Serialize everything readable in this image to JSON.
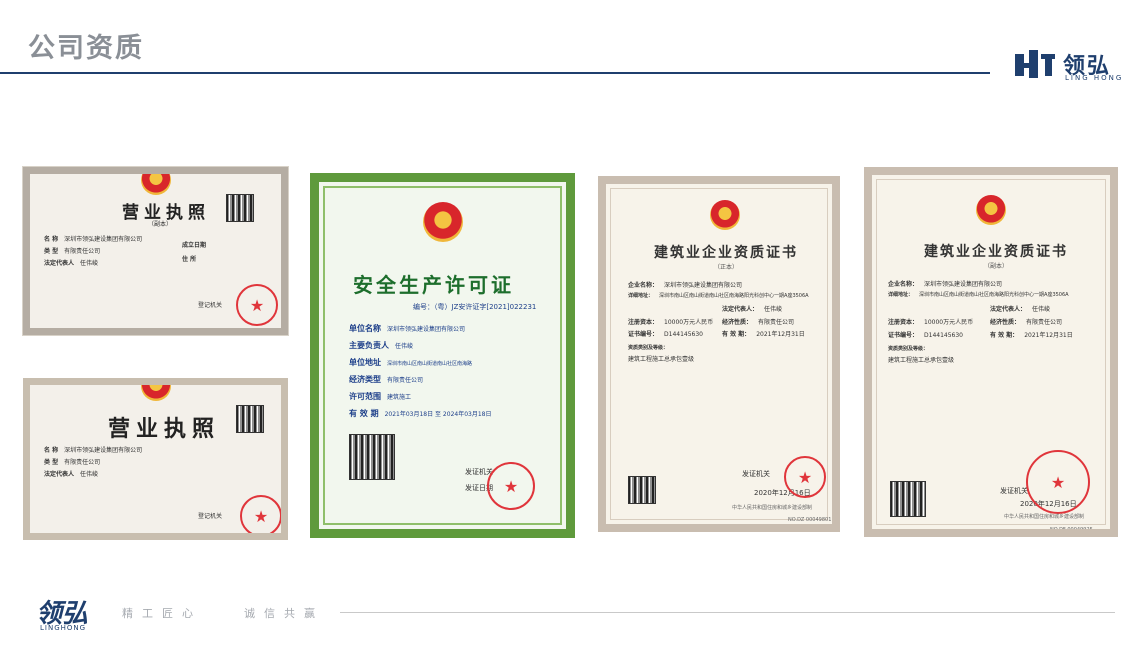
{
  "header": {
    "title": "公司资质"
  },
  "brand": {
    "name_cn": "领弘",
    "name_en": "LING HONG"
  },
  "license1": {
    "title": "营业执照",
    "subtitle": "（副本）",
    "fields": [
      {
        "label": "名 称",
        "value": "深圳市领弘建设集团有限公司"
      },
      {
        "label": "类 型",
        "value": "有限责任公司"
      },
      {
        "label": "法定代表人",
        "value": "任伟峻"
      },
      {
        "label": "成立日期",
        "value": ""
      },
      {
        "label": "住 所",
        "value": ""
      }
    ],
    "authority": "登记机关"
  },
  "license2": {
    "title": "营业执照",
    "fields": [
      {
        "label": "名 称",
        "value": "深圳市领弘建设集团有限公司"
      },
      {
        "label": "类 型",
        "value": "有限责任公司"
      },
      {
        "label": "法定代表人",
        "value": "任伟峻"
      }
    ],
    "authority": "登记机关"
  },
  "permit": {
    "title": "安全生产许可证",
    "number": "编号：（粤）JZ安许证字[2021]022231",
    "fields": [
      {
        "label": "单位名称",
        "value": "深圳市领弘建设集团有限公司"
      },
      {
        "label": "主要负责人",
        "value": "任伟峻"
      },
      {
        "label": "单位地址",
        "value": "深圳市南山区南山街道南山社区南海路"
      },
      {
        "label": "经济类型",
        "value": "有限责任公司"
      },
      {
        "label": "许可范围",
        "value": "建筑施工"
      },
      {
        "label": "有 效 期",
        "value": "2021年03月18日 至 2024年03月18日"
      }
    ],
    "authority": "发证机关",
    "date": "发证日期"
  },
  "cert1": {
    "title": "建筑业企业资质证书",
    "subtitle": "（正本）",
    "fields": [
      {
        "label": "企业名称：",
        "value": "深圳市领弘建设集团有限公司"
      },
      {
        "label": "详细地址：",
        "value": "深圳市南山区南山街道南山社区南海路阳光科创中心一期A座3506A"
      },
      {
        "label": "注册资本：",
        "value": "10000万元人民币"
      },
      {
        "label": "证书编号：",
        "value": "D144145630"
      },
      {
        "label": "资质类别及等级：",
        "value": "建筑工程施工总承包壹级"
      }
    ],
    "rep_label": "法定代表人：",
    "rep_value": "任伟峻",
    "type_label": "经济性质：",
    "type_value": "有限责任公司",
    "valid_label": "有 效 期：",
    "valid_value": "2021年12月31日",
    "authority": "发证机关",
    "date": "2020年12月16日",
    "footer": "中华人民共和国住房和城乡建设部制",
    "code": "NO.DZ 00049801"
  },
  "cert2": {
    "title": "建筑业企业资质证书",
    "subtitle": "（副本）",
    "fields": [
      {
        "label": "企业名称：",
        "value": "深圳市领弘建设集团有限公司"
      },
      {
        "label": "详细地址：",
        "value": "深圳市南山区南山街道南山社区南海路阳光科创中心一期A座3506A"
      },
      {
        "label": "注册资本：",
        "value": "10000万元人民币"
      },
      {
        "label": "证书编号：",
        "value": "D144145630"
      },
      {
        "label": "资质类别及等级：",
        "value": "建筑工程施工总承包壹级"
      }
    ],
    "rep_label": "法定代表人：",
    "rep_value": "任伟峻",
    "type_label": "经济性质：",
    "type_value": "有限责任公司",
    "valid_label": "有 效 期：",
    "valid_value": "2021年12月31日",
    "authority": "发证机关",
    "date": "2020年12月16日",
    "footer": "中华人民共和国住房和城乡建设部制",
    "code": "NO.DF 00049925"
  },
  "footer": {
    "logo": "领弘",
    "logo_en": "LINGHONG",
    "slogan_left": "精工匠心",
    "slogan_right": "诚信共赢"
  }
}
